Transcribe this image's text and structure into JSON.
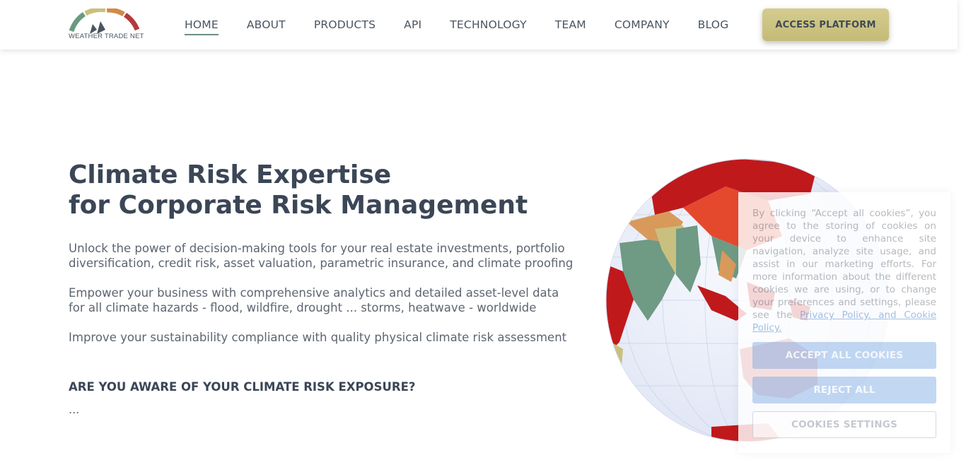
{
  "header": {
    "logo_text": "WEATHER TRADE NET",
    "nav": [
      {
        "label": "HOME",
        "active": true
      },
      {
        "label": "ABOUT"
      },
      {
        "label": "PRODUCTS"
      },
      {
        "label": "API"
      },
      {
        "label": "TECHNOLOGY"
      },
      {
        "label": "TEAM"
      },
      {
        "label": "COMPANY"
      },
      {
        "label": "BLOG"
      }
    ],
    "cta_label": "ACCESS PLATFORM",
    "colors": {
      "cta": "#c9c07f",
      "nav_underline": "#6a8f84"
    }
  },
  "hero": {
    "title_line1": "Climate Risk Expertise",
    "title_line2": "for Corporate Risk Management",
    "paragraph1_line1": "Unlock the power of decision-making tools for your real estate investments, portfolio",
    "paragraph1_line2": "diversification, credit risk, asset valuation, parametric insurance, and climate proofing",
    "paragraph2_line1": "Empower your business with comprehensive analytics and detailed asset-level data",
    "paragraph2_line2": "for all climate hazards - flood, wildfire, drought ... storms, heatwave - worldwide",
    "paragraph3": "Improve your sustainability compliance with quality physical climate risk assessment",
    "question": "ARE YOU AWARE OF YOUR CLIMATE RISK EXPOSURE?",
    "ellipsis": "..."
  },
  "globe": {
    "icon": "globe-risk-map",
    "colors": {
      "high": "#c0191c",
      "medium": "#e4492e",
      "low": "#6f9a84",
      "ocean": "#eef1fb"
    }
  },
  "cookie_banner": {
    "text": "By clicking “Accept all cookies”, you agree to the storing of cookies on your device to enhance site navigation, analyze site usage, and assist in our marketing efforts. For more information about the different cookies we are using, or to change your preferences and settings, please see the",
    "link_text": "Privacy Policy. and Cookie Policy.",
    "accept_label": "ACCEPT ALL COOKIES",
    "reject_label": "REJECT ALL",
    "settings_label": "COOKIES SETTINGS"
  }
}
